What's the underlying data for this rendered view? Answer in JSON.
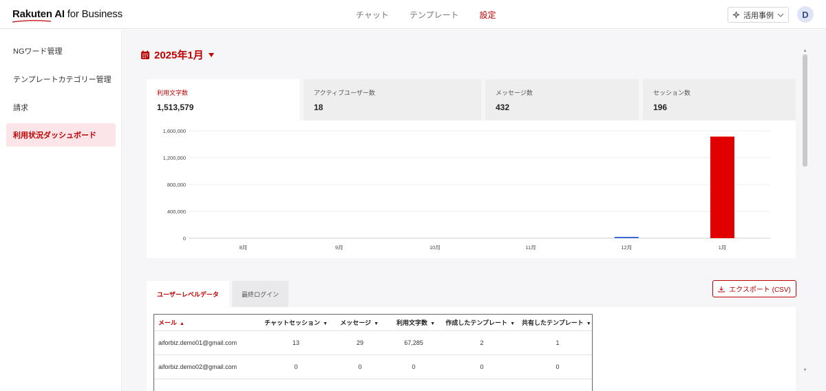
{
  "header": {
    "logo_brand": "Rakuten AI",
    "logo_suffix": " for Business",
    "nav": [
      {
        "label": "チャット",
        "active": false
      },
      {
        "label": "テンプレート",
        "active": false
      },
      {
        "label": "設定",
        "active": true
      }
    ],
    "usecase_label": "活用事例",
    "avatar_initial": "D"
  },
  "sidebar": {
    "items": [
      {
        "label": "NGワード管理",
        "active": false
      },
      {
        "label": "テンプレートカテゴリー管理",
        "active": false
      },
      {
        "label": "請求",
        "active": false
      },
      {
        "label": "利用状況ダッシュボード",
        "active": true
      }
    ]
  },
  "month_selector": {
    "label": "2025年1月"
  },
  "stat_tabs": [
    {
      "label": "利用文字数",
      "value": "1,513,579",
      "active": true
    },
    {
      "label": "アクティブユーザー数",
      "value": "18",
      "active": false
    },
    {
      "label": "メッセージ数",
      "value": "432",
      "active": false
    },
    {
      "label": "セッション数",
      "value": "196",
      "active": false
    }
  ],
  "chart_data": {
    "type": "bar",
    "title": "",
    "xlabel": "",
    "ylabel": "",
    "categories": [
      "8月",
      "9月",
      "10月",
      "11月",
      "12月",
      "1月"
    ],
    "values": [
      0,
      0,
      0,
      0,
      20000,
      1513579
    ],
    "bar_colors": [
      "#bf0000",
      "#bf0000",
      "#bf0000",
      "#bf0000",
      "#3a66d6",
      "#e00000"
    ],
    "ylim": [
      0,
      1600000
    ],
    "yticks": [
      0,
      400000,
      800000,
      1200000,
      1600000
    ],
    "ytick_labels": [
      "0",
      "400,000",
      "800,000",
      "1,200,000",
      "1,600,000"
    ],
    "grid": true
  },
  "sub_tabs": [
    {
      "label": "ユーザーレベルデータ",
      "active": true
    },
    {
      "label": "最終ログイン",
      "active": false
    }
  ],
  "export_label": "エクスポート (CSV)",
  "table": {
    "columns": [
      {
        "label": "メール",
        "sort": "▲"
      },
      {
        "label": "チャットセッション",
        "sort": "▼"
      },
      {
        "label": "メッセージ",
        "sort": "▼"
      },
      {
        "label": "利用文字数",
        "sort": "▼"
      },
      {
        "label": "作成したテンプレート",
        "sort": "▼"
      },
      {
        "label": "共有したテンプレート",
        "sort": "▼"
      }
    ],
    "rows": [
      [
        "aiforbiz.demo01@gmail.com",
        "13",
        "29",
        "67,285",
        "2",
        "1"
      ],
      [
        "aiforbiz.demo02@gmail.com",
        "0",
        "0",
        "0",
        "0",
        "0"
      ]
    ]
  },
  "colors": {
    "accent": "#bf0000",
    "active_bg": "#fbe5e9",
    "main_bg": "#f6f5f7"
  },
  "icons": [
    "sparkle-icon",
    "chevron-down-icon",
    "calendar-icon",
    "caret-down-icon",
    "download-icon"
  ]
}
